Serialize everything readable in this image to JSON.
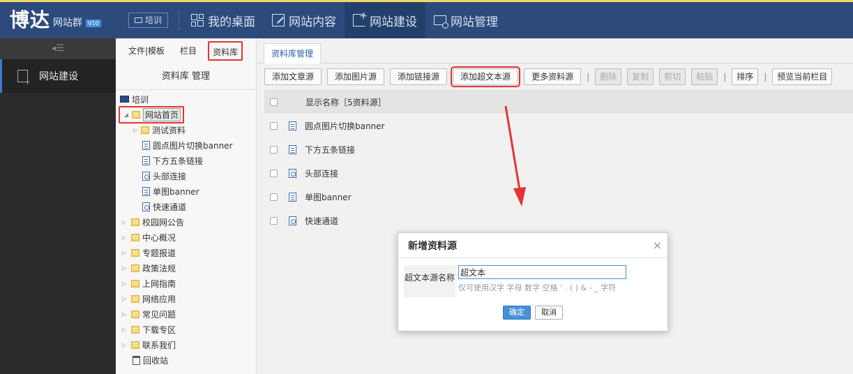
{
  "header": {
    "logo_main": "博达",
    "logo_sub": "网站群",
    "logo_version": "V10",
    "site_button": "培训",
    "nav": [
      {
        "label": "我的桌面",
        "icon": "grid-icon"
      },
      {
        "label": "网站内容",
        "icon": "edit-icon"
      },
      {
        "label": "网站建设",
        "icon": "build-icon"
      },
      {
        "label": "网站管理",
        "icon": "manage-icon"
      }
    ]
  },
  "leftbar": {
    "toggle": "◂☰",
    "item": "网站建设"
  },
  "tree_panel": {
    "tabs": [
      "文件|模板",
      "栏目",
      "资料库"
    ],
    "header": "资料库 管理",
    "root": "培训",
    "selected": "网站首页",
    "children": [
      {
        "label": "测试资料",
        "type": "folder"
      },
      {
        "label": "圆点图片切换banner",
        "type": "doc"
      },
      {
        "label": "下方五条链接",
        "type": "doc"
      },
      {
        "label": "头部连接",
        "type": "link"
      },
      {
        "label": "单图banner",
        "type": "doc"
      },
      {
        "label": "快速通道",
        "type": "link"
      }
    ],
    "folders": [
      "校园网公告",
      "中心概况",
      "专题报道",
      "政策法规",
      "上网指南",
      "网络应用",
      "常见问题",
      "下载专区",
      "联系我们"
    ],
    "recycle": "回收站"
  },
  "main": {
    "tab": "资料库管理",
    "toolbar": {
      "add_article": "添加文章源",
      "add_image": "添加图片源",
      "add_link": "添加链接源",
      "add_richtext": "添加超文本源",
      "more": "更多资料源",
      "sep": "|",
      "delete": "删除",
      "copy": "复制",
      "cut": "剪切",
      "paste": "粘贴",
      "sort": "排序",
      "preview": "预览当前栏目"
    },
    "grid_header": "显示名称［5资料源］",
    "rows": [
      {
        "label": "圆点图片切换banner",
        "type": "doc"
      },
      {
        "label": "下方五条链接",
        "type": "doc"
      },
      {
        "label": "头部连接",
        "type": "link"
      },
      {
        "label": "单图banner",
        "type": "doc"
      },
      {
        "label": "快速通道",
        "type": "link"
      }
    ]
  },
  "dialog": {
    "title": "新增资料源",
    "close": "×",
    "field_label": "超文本源名称",
    "field_value": "超文本",
    "hint": "仅可使用汉字 字母 数字 空格 ’ . ( ) & - _ 字符",
    "ok": "确定",
    "cancel": "取消"
  },
  "colors": {
    "header_bg": "#2c4b7c",
    "accent_border": "#f4d36a",
    "annotation_red": "#e53333",
    "primary_button": "#4a90d9"
  }
}
